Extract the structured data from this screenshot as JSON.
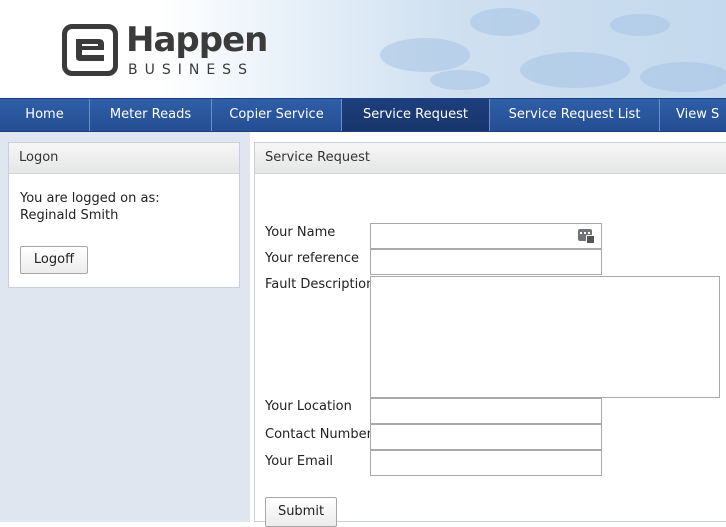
{
  "header": {
    "logo_word": "Happen",
    "logo_sub": "BUSINESS"
  },
  "nav": {
    "items": [
      {
        "label": "Home"
      },
      {
        "label": "Meter Reads"
      },
      {
        "label": "Copier Service"
      },
      {
        "label": "Service Request",
        "active": true
      },
      {
        "label": "Service Request List"
      },
      {
        "label": "View S"
      }
    ]
  },
  "logon": {
    "title": "Logon",
    "line1": "You are logged on as:",
    "user": "Reginald Smith",
    "logoff_label": "Logoff"
  },
  "service_request": {
    "title": "Service Request",
    "labels": {
      "name": "Your Name",
      "reference": "Your reference",
      "fault": "Fault Description",
      "location": "Your Location",
      "contact": "Contact Number",
      "email": "Your Email"
    },
    "values": {
      "name": "",
      "reference": "",
      "fault": "",
      "location": "",
      "contact": "",
      "email": ""
    },
    "submit_label": "Submit"
  },
  "colors": {
    "nav_bg": "#2a589f",
    "nav_active": "#1b3a75",
    "sidebar_bg": "#dfe6ef"
  },
  "icons": {
    "name_field_icon": "autofill-card-icon"
  }
}
